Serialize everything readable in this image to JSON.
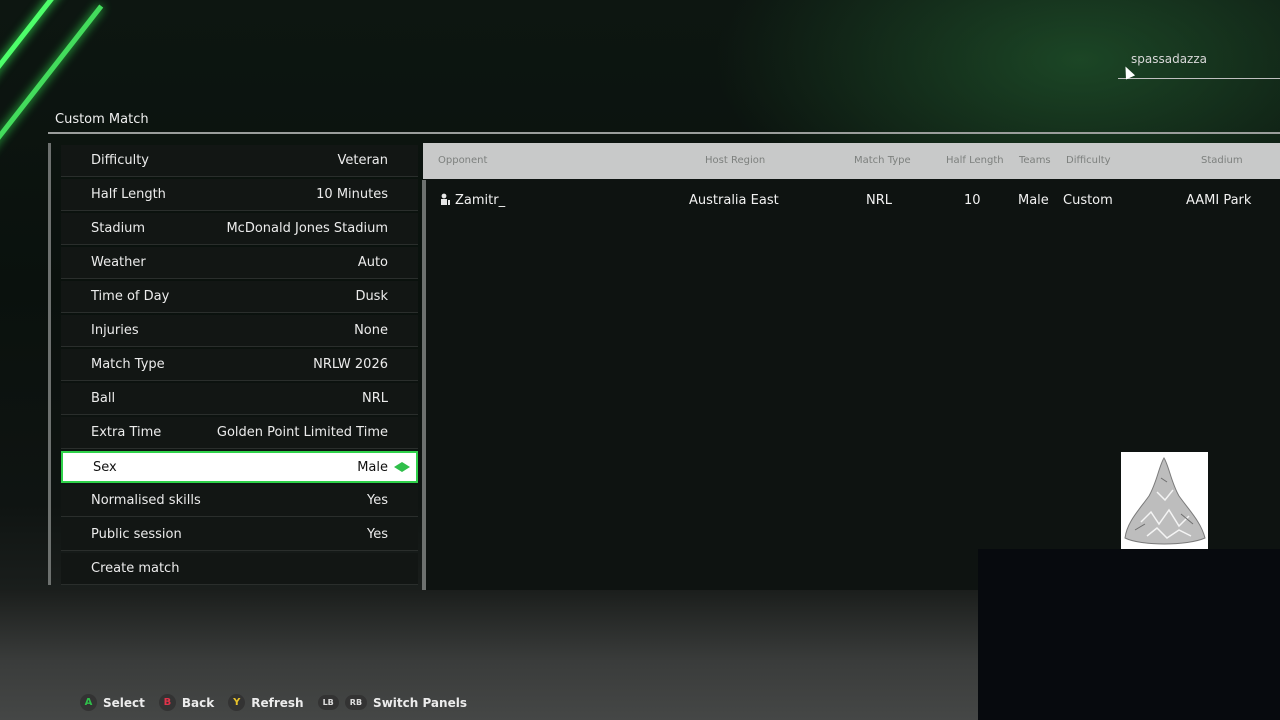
{
  "user": {
    "gamertag": "spassadazza"
  },
  "page": {
    "title": "Custom Match"
  },
  "settings": [
    {
      "label": "Difficulty",
      "value": "Veteran"
    },
    {
      "label": "Half Length",
      "value": "10 Minutes"
    },
    {
      "label": "Stadium",
      "value": "McDonald Jones Stadium"
    },
    {
      "label": "Weather",
      "value": "Auto"
    },
    {
      "label": "Time of Day",
      "value": "Dusk"
    },
    {
      "label": "Injuries",
      "value": "None"
    },
    {
      "label": "Match Type",
      "value": "NRLW 2026"
    },
    {
      "label": "Ball",
      "value": "NRL"
    },
    {
      "label": "Extra Time",
      "value": "Golden Point Limited Time"
    },
    {
      "label": "Sex",
      "value": "Male"
    },
    {
      "label": "Normalised skills",
      "value": "Yes"
    },
    {
      "label": "Public session",
      "value": "Yes"
    },
    {
      "label": "Create match",
      "value": ""
    }
  ],
  "results": {
    "columns": [
      "Opponent",
      "Host Region",
      "Match Type",
      "Half Length",
      "Teams",
      "Difficulty",
      "Stadium"
    ],
    "rows": [
      {
        "opponent": "Zamitr_",
        "host_region": "Australia East",
        "match_type": "NRL",
        "half_length": "10",
        "teams": "Male",
        "difficulty": "Custom",
        "stadium": "AAMI Park"
      }
    ]
  },
  "footer": {
    "select": {
      "button": "A",
      "label": "Select",
      "color": "#2fbf4a"
    },
    "back": {
      "button": "B",
      "label": "Back",
      "color": "#e0334a"
    },
    "refresh": {
      "button": "Y",
      "label": "Refresh",
      "color": "#e8c22a"
    },
    "switch": {
      "lb": "LB",
      "rb": "RB",
      "label": "Switch Panels"
    }
  },
  "colors": {
    "accent": "#2fd14a",
    "neon": "#4dff6a"
  }
}
